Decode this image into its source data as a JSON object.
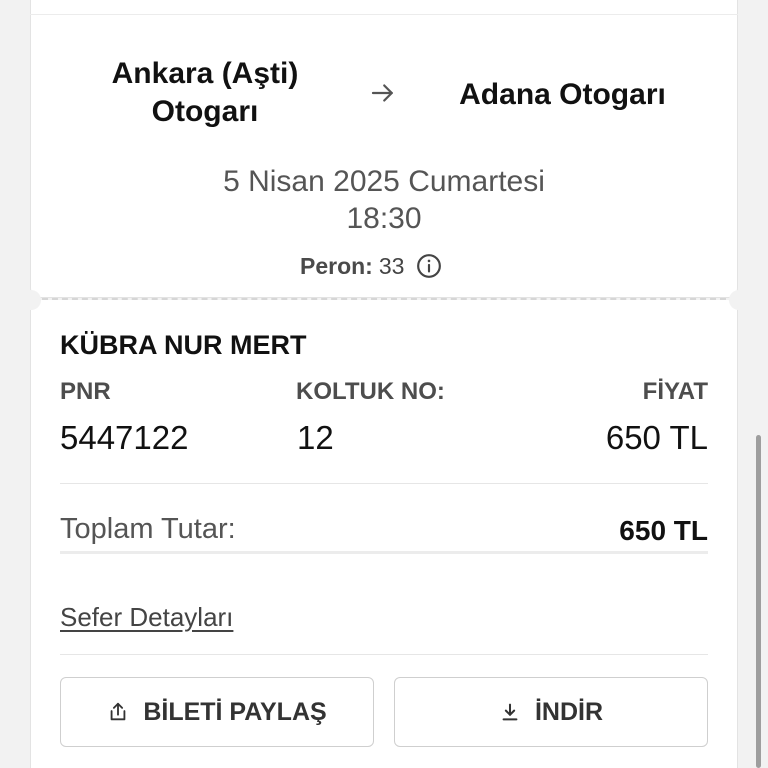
{
  "route": {
    "from": "Ankara (Aşti) Otogarı",
    "to": "Adana Otogarı",
    "arrow_icon": "arrow-right-icon"
  },
  "departure": {
    "date": "5 Nisan 2025 Cumartesi",
    "time": "18:30"
  },
  "platform": {
    "label": "Peron:",
    "value": "33",
    "info_icon": "info-icon"
  },
  "passenger": {
    "name": "KÜBRA NUR MERT"
  },
  "columns": {
    "pnr_label": "PNR",
    "pnr_value": "5447122",
    "seat_label": "KOLTUK NO:",
    "seat_value": "12",
    "price_label": "FİYAT",
    "price_value": "650 TL"
  },
  "total": {
    "label": "Toplam Tutar:",
    "value": "650 TL"
  },
  "links": {
    "trip_details": "Sefer Detayları"
  },
  "actions": {
    "share_label": "BİLETİ PAYLAŞ",
    "share_icon": "share-icon",
    "download_label": "İNDİR",
    "download_icon": "download-icon"
  },
  "colors": {
    "background": "#f2f2f2",
    "card": "#ffffff",
    "text_primary": "#111111",
    "text_secondary": "#555555"
  }
}
